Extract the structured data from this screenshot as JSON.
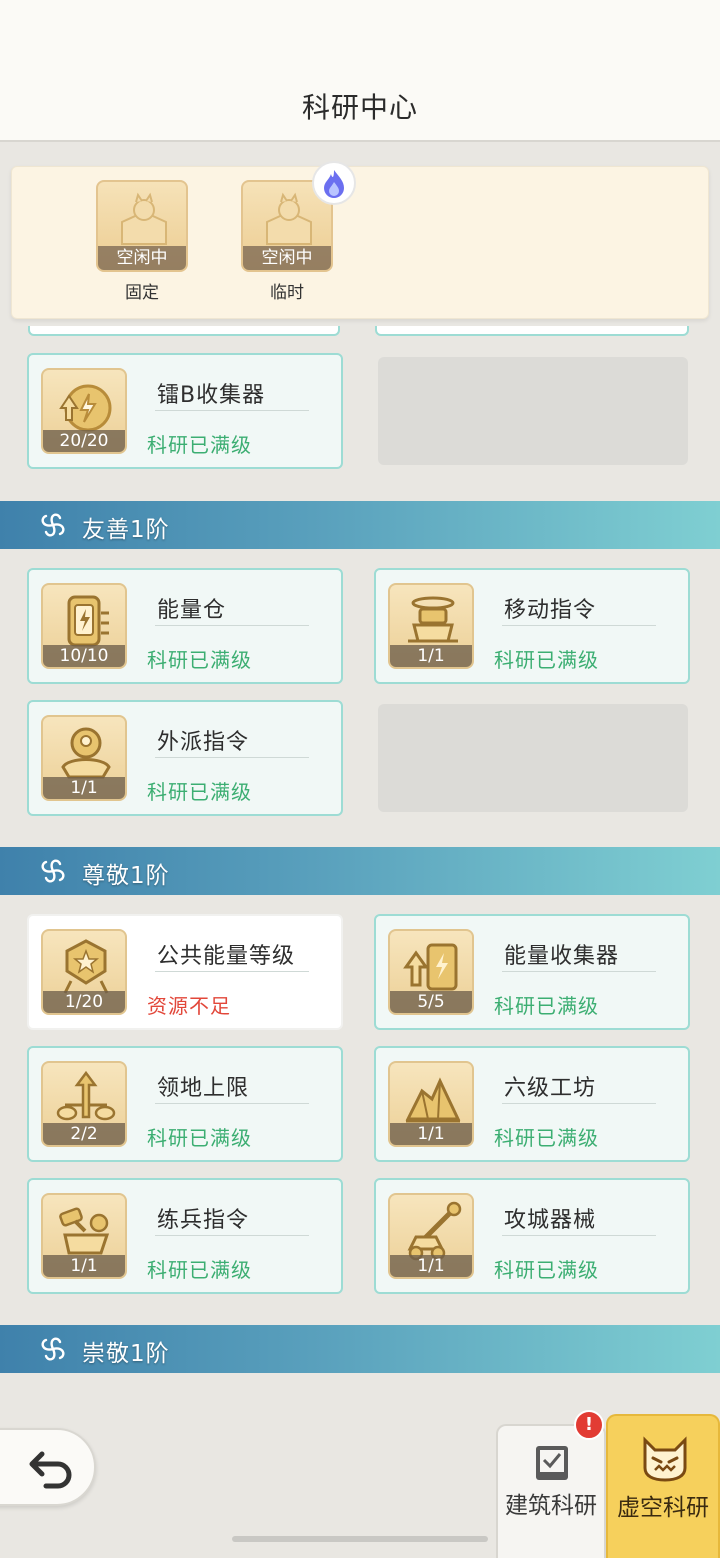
{
  "header": {
    "title": "科研中心"
  },
  "queue": {
    "slots": [
      {
        "state": "空闲中",
        "kind": "固定"
      },
      {
        "state": "空闲中",
        "kind": "临时"
      }
    ]
  },
  "sections": [
    {
      "cards": [
        {
          "name": "镭B收集器",
          "level": "20/20",
          "status": "科研已满级",
          "icon": "lightning-upgrade-icon"
        }
      ]
    },
    {
      "label": "友善1阶",
      "cards": [
        {
          "name": "能量仓",
          "level": "10/10",
          "status": "科研已满级",
          "icon": "energy-tank-icon"
        },
        {
          "name": "移动指令",
          "level": "1/1",
          "status": "科研已满级",
          "icon": "move-drone-icon"
        },
        {
          "name": "外派指令",
          "level": "1/1",
          "status": "科研已满级",
          "icon": "dispatch-pin-icon"
        }
      ]
    },
    {
      "label": "尊敬1阶",
      "cards": [
        {
          "name": "公共能量等级",
          "level": "1/20",
          "status": "资源不足",
          "icon": "star-emblem-icon"
        },
        {
          "name": "能量收集器",
          "level": "5/5",
          "status": "科研已满级",
          "icon": "collector-upgrade-icon"
        },
        {
          "name": "领地上限",
          "level": "2/2",
          "status": "科研已满级",
          "icon": "territory-arrows-icon"
        },
        {
          "name": "六级工坊",
          "level": "1/1",
          "status": "科研已满级",
          "icon": "gold-ore-icon"
        },
        {
          "name": "练兵指令",
          "level": "1/1",
          "status": "科研已满级",
          "icon": "training-hammer-icon"
        },
        {
          "name": "攻城器械",
          "level": "1/1",
          "status": "科研已满级",
          "icon": "catapult-icon"
        }
      ]
    },
    {
      "label": "崇敬1阶"
    }
  ],
  "tabs": {
    "build": "建筑科研",
    "void": "虚空科研",
    "alert": "!"
  },
  "colors": {
    "maxed": "#3cae72",
    "insufficient": "#e2473a",
    "section_start": "#3f81ab",
    "section_end": "#7fcfd2"
  }
}
